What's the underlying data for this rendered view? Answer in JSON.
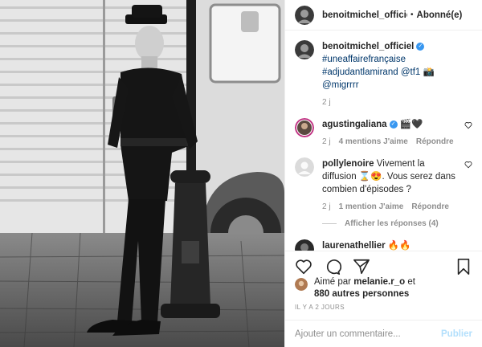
{
  "post": {
    "image_alt": "Black and white photo of a man in a gendarme uniform leaning against a bollard in front of a van",
    "author": "benoitmichel_officiel",
    "follow_label": "Abonné(e)"
  },
  "caption": {
    "username": "benoitmichel_officiel",
    "hashtag1": "#uneaffairefrançaise",
    "hashtag2": "#adjudantlamirand",
    "mention1": "@tf1",
    "emoji": "📸",
    "mention2": "@migrrrr",
    "age": "2 j"
  },
  "comments": [
    {
      "username": "agustingaliana",
      "text": "🎬🖤",
      "age": "2 j",
      "likes": "4 mentions J'aime",
      "reply_label": "Répondre"
    },
    {
      "username": "pollylenoire",
      "text": "Vivement la diffusion ⌛😍. Vous serez dans combien d'épisodes ?",
      "age": "2 j",
      "likes": "1 mention J'aime",
      "reply_label": "Répondre",
      "view_replies": "Afficher les réponses (4)"
    },
    {
      "username": "laurenathellier",
      "text": "🔥🔥"
    }
  ],
  "likes": {
    "prefix": "Aimé par ",
    "user": "melanie.r_o",
    "middle": " et",
    "others": "880 autres personnes"
  },
  "timestamp": "IL Y A 2 JOURS",
  "add_comment": {
    "placeholder": "Ajouter un commentaire...",
    "publish_label": "Publier"
  },
  "colors": {
    "link": "#00376b",
    "muted": "#8e8e8e",
    "publish_disabled": "#b2dffc",
    "verified": "#3897f0"
  }
}
